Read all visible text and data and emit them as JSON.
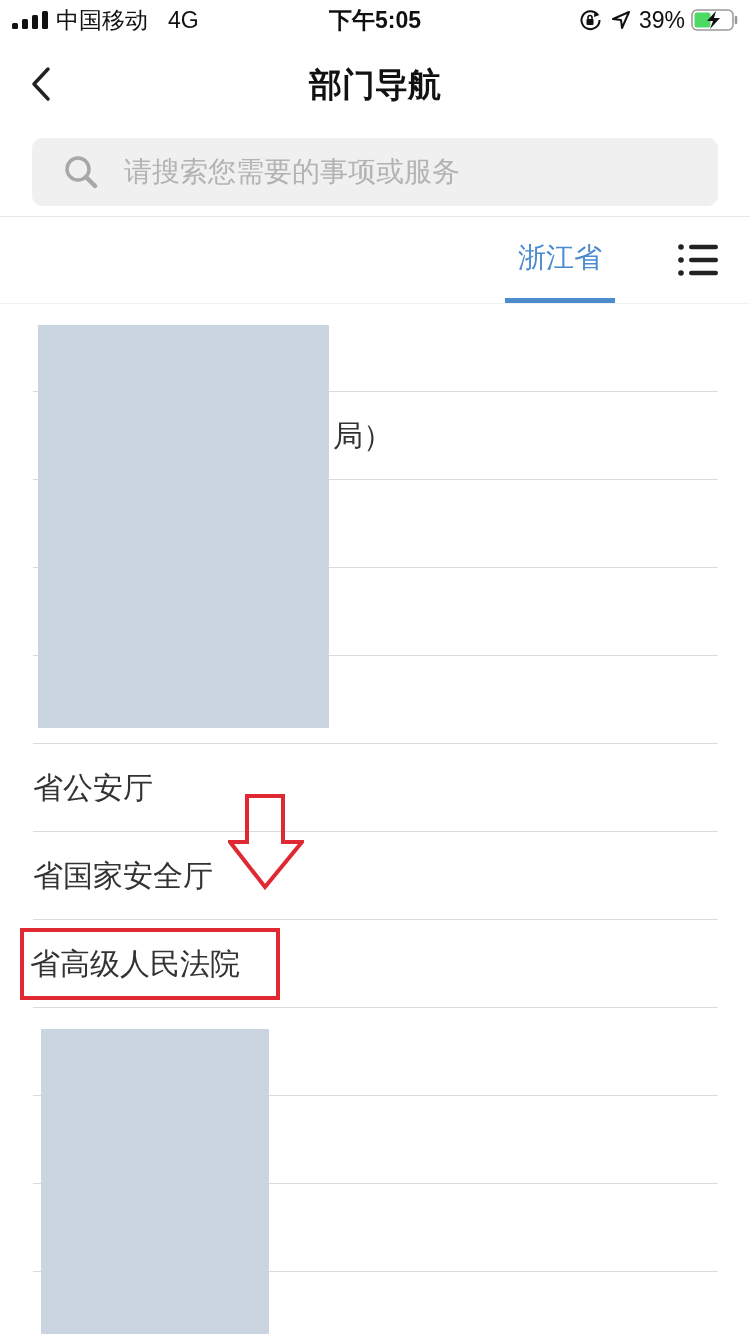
{
  "status_bar": {
    "carrier": "中国移动",
    "network": "4G",
    "time": "下午5:05",
    "battery": "39%"
  },
  "nav": {
    "title": "部门导航"
  },
  "search": {
    "placeholder": "请搜索您需要的事项或服务"
  },
  "tabs": [
    {
      "label": "浙江省",
      "selected": true
    }
  ],
  "departments": [
    {
      "covered": true,
      "highlighted": false
    },
    {
      "label": "局）",
      "covered": true,
      "highlighted": false
    },
    {
      "covered": true,
      "highlighted": false
    },
    {
      "covered": true,
      "highlighted": false
    },
    {
      "covered": true,
      "highlighted": false
    },
    {
      "label": "省公安厅",
      "covered": false,
      "highlighted": false
    },
    {
      "label": "省国家安全厅",
      "covered": false,
      "highlighted": false
    },
    {
      "label": "省高级人民法院",
      "covered": false,
      "highlighted": true
    },
    {
      "covered": true,
      "highlighted": false
    },
    {
      "covered": true,
      "highlighted": false
    },
    {
      "covered": true,
      "highlighted": false
    },
    {
      "covered": true,
      "highlighted": false
    }
  ]
}
